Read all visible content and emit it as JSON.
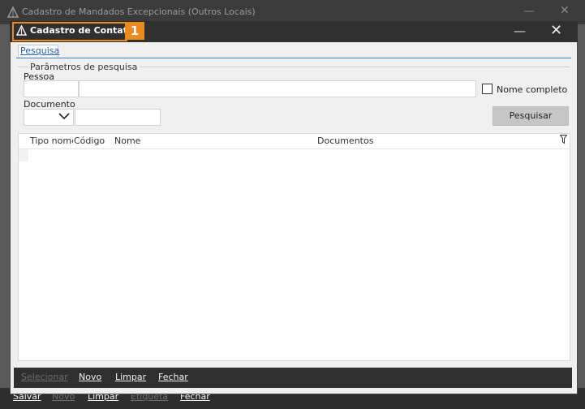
{
  "background_window": {
    "title": "Cadastro de Mandados Excepcionais (Outros Locais)",
    "footer": {
      "salvar": "Salvar",
      "novo": "Novo",
      "limpar": "Limpar",
      "etiqueta": "Etiqueta",
      "fechar": "Fechar"
    }
  },
  "dialog": {
    "title": "Cadastro de Contatos",
    "badge": "1",
    "tab": "Pesquisa",
    "group_label": "Parâmetros de pesquisa",
    "pessoa_label": "Pessoa",
    "pessoa_code_value": "",
    "pessoa_name_value": "",
    "nome_completo_label": "Nome completo",
    "documento_label": "Documento",
    "documento_type_value": "",
    "documento_value": "",
    "pesquisar_button": "Pesquisar",
    "grid": {
      "columns": [
        "Tipo nome",
        "Código",
        "Nome",
        "Documentos"
      ],
      "rows": []
    },
    "footer": {
      "selecionar": "Selecionar",
      "novo": "Novo",
      "limpar": "Limpar",
      "fechar": "Fechar"
    }
  },
  "colors": {
    "highlight": "#e98b1f",
    "tab_link": "#2b5aa0",
    "footer_bg": "#2f2f2f"
  }
}
